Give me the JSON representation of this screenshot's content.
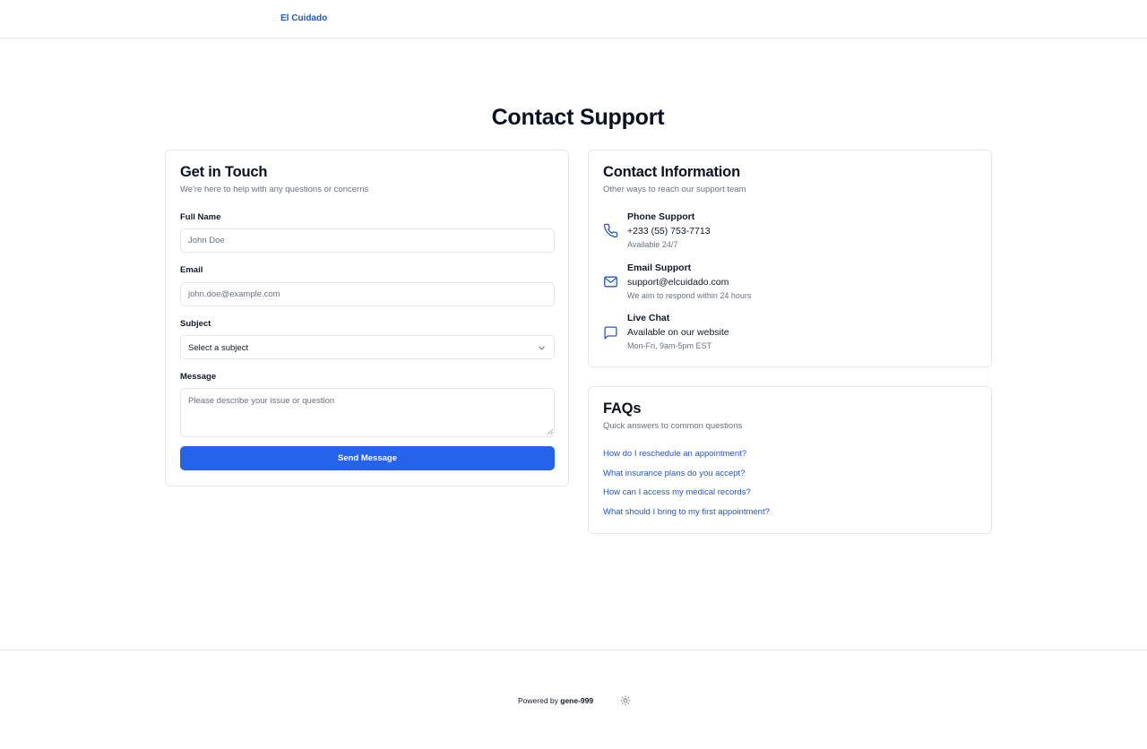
{
  "header": {
    "brand": "El Cuidado"
  },
  "page": {
    "title": "Contact Support"
  },
  "form_card": {
    "title": "Get in Touch",
    "subtitle": "We're here to help with any questions or concerns",
    "full_name": {
      "label": "Full Name",
      "placeholder": "John Doe",
      "value": ""
    },
    "email": {
      "label": "Email",
      "placeholder": "john.doe@example.com",
      "value": ""
    },
    "subject": {
      "label": "Subject",
      "selected": "Select a subject"
    },
    "message": {
      "label": "Message",
      "placeholder": "Please describe your issue or question",
      "value": ""
    },
    "submit_label": "Send Message"
  },
  "contact_card": {
    "title": "Contact Information",
    "subtitle": "Other ways to reach our support team",
    "items": [
      {
        "icon": "phone-icon",
        "title": "Phone Support",
        "value": "+233 (55) 753-7713",
        "note": "Available 24/7"
      },
      {
        "icon": "mail-icon",
        "title": "Email Support",
        "value": "support@elcuidado.com",
        "note": "We aim to respond within 24 hours"
      },
      {
        "icon": "chat-icon",
        "title": "Live Chat",
        "value": "Available on our website",
        "note": "Mon-Fri, 9am-5pm EST"
      }
    ]
  },
  "faq_card": {
    "title": "FAQs",
    "subtitle": "Quick answers to common questions",
    "links": [
      "How do I reschedule an appointment?",
      "What insurance plans do you accept?",
      "How can I access my medical records?",
      "What should I bring to my first appointment?"
    ]
  },
  "footer": {
    "powered_prefix": "Powered by",
    "powered_brand": "gene-999",
    "theme_icon": "sun-icon"
  },
  "colors": {
    "accent": "#2563eb",
    "link": "#2457c5",
    "border": "#e5e7eb",
    "muted": "#6b7280"
  }
}
